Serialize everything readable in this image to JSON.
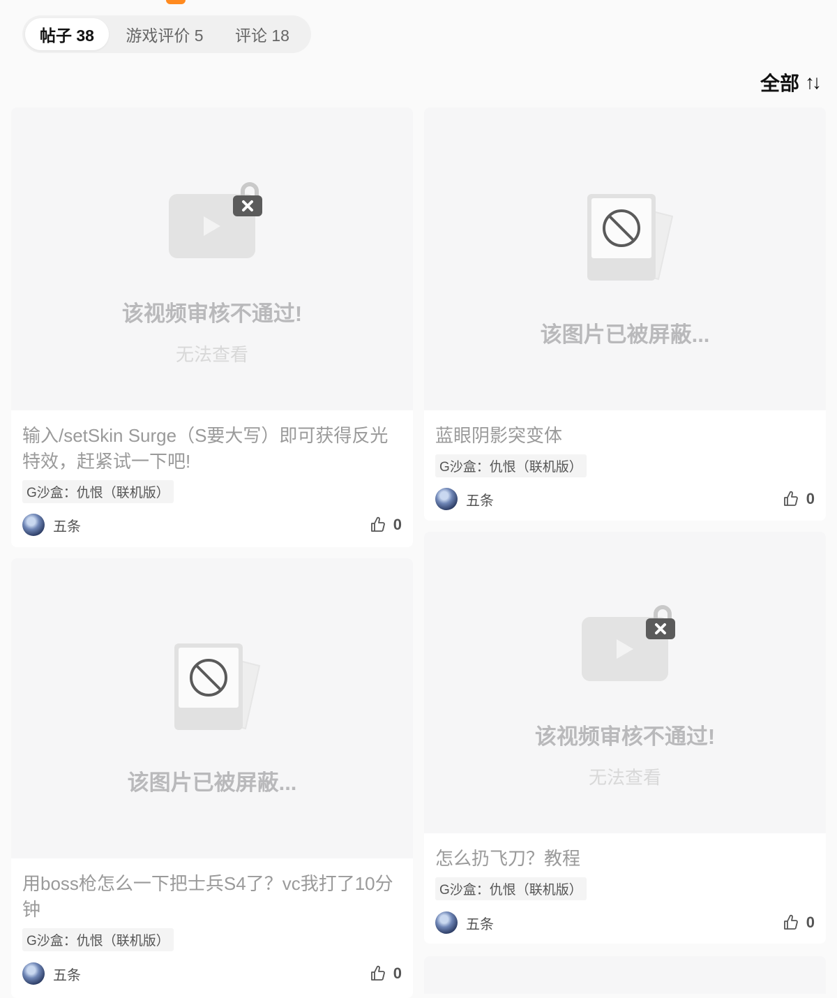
{
  "tabs": [
    {
      "label": "帖子 38",
      "active": true
    },
    {
      "label": "游戏评价 5",
      "active": false
    },
    {
      "label": "评论 18",
      "active": false
    }
  ],
  "sort": {
    "label": "全部",
    "icon": "sort-icon"
  },
  "colors": {
    "accent": "#ff8a1f"
  },
  "posts": [
    {
      "placeholder": {
        "type": "video-rejected",
        "icon": "video-lock-icon",
        "title": "该视频审核不通过!",
        "subtitle": "无法查看"
      },
      "title": "输入/setSkin Surge（S要大写）即可获得反光特效，赶紧试一下吧!",
      "game": "G沙盒：仇恨（联机版）",
      "author": "五条",
      "likes": "0"
    },
    {
      "placeholder": {
        "type": "image-blocked",
        "icon": "blocked-image-icon",
        "title": "该图片已被屏蔽..."
      },
      "title": "蓝眼阴影突变体",
      "game": "G沙盒：仇恨（联机版）",
      "author": "五条",
      "likes": "0"
    },
    {
      "placeholder": {
        "type": "image-blocked",
        "icon": "blocked-image-icon",
        "title": "该图片已被屏蔽..."
      },
      "title": "用boss枪怎么一下把士兵S4了？vc我打了10分钟",
      "game": "G沙盒：仇恨（联机版）",
      "author": "五条",
      "likes": "0"
    },
    {
      "placeholder": {
        "type": "video-rejected",
        "icon": "video-lock-icon",
        "title": "该视频审核不通过!",
        "subtitle": "无法查看"
      },
      "title": "怎么扔飞刀？教程",
      "game": "G沙盒：仇恨（联机版）",
      "author": "五条",
      "likes": "0"
    }
  ]
}
